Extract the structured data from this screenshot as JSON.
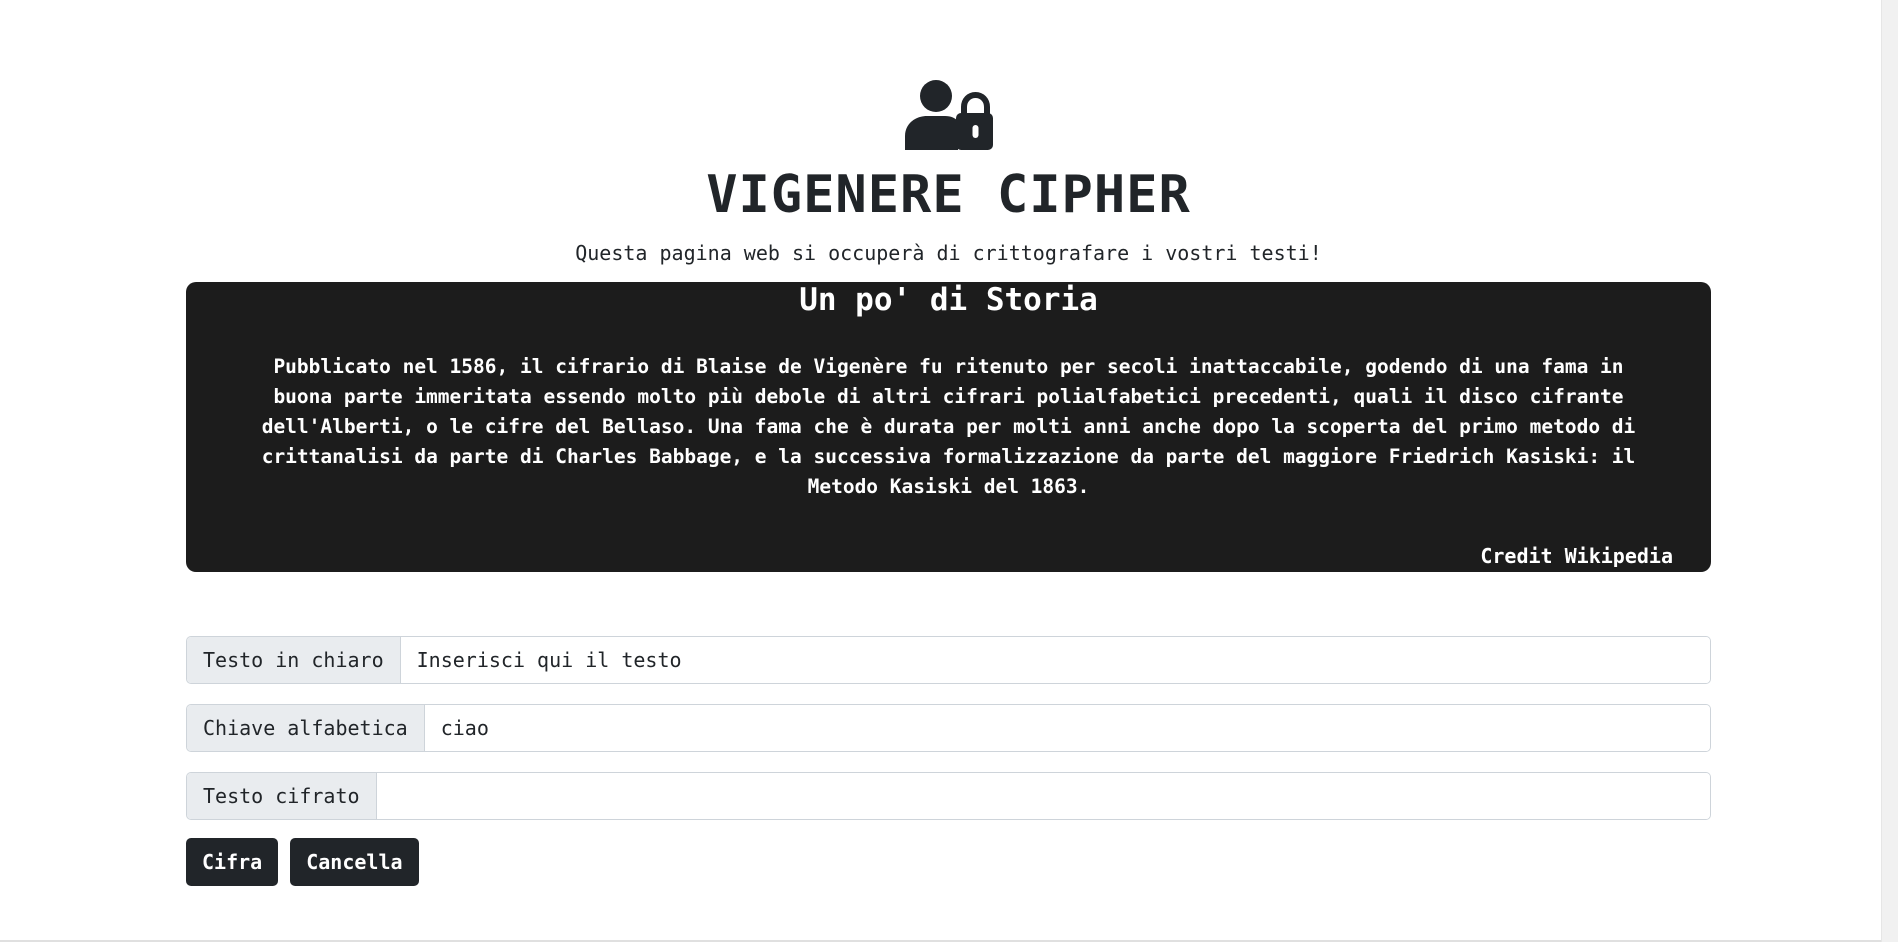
{
  "header": {
    "icon": "user-lock-icon",
    "title": "VIGENERE CIPHER",
    "subtitle": "Questa pagina web si occuperà di crittografare i vostri testi!"
  },
  "history": {
    "title": "Un po' di Storia",
    "text": "Pubblicato nel 1586, il cifrario di Blaise de Vigenère fu ritenuto per secoli inattaccabile, godendo di una fama in buona parte immeritata essendo molto più debole di altri cifrari polialfabetici precedenti, quali il disco cifrante dell'Alberti, o le cifre del Bellaso. Una fama che è durata per molti anni anche dopo la scoperta del primo metodo di crittanalisi da parte di Charles Babbage, e la successiva formalizzazione da parte del maggiore Friedrich Kasiski: il Metodo Kasiski del 1863.",
    "credit": "Credit Wikipedia"
  },
  "form": {
    "plaintext": {
      "label": "Testo in chiaro",
      "placeholder": "Inserisci qui il testo",
      "value": ""
    },
    "key": {
      "label": "Chiave alfabetica",
      "placeholder": "",
      "value": "ciao"
    },
    "ciphertext": {
      "label": "Testo cifrato",
      "placeholder": "",
      "value": ""
    }
  },
  "buttons": {
    "encrypt_label": "Cifra",
    "clear_label": "Cancella"
  },
  "colors": {
    "dark": "#212529",
    "card_background": "#1c1c1c",
    "label_background": "#e9ecef",
    "border": "#ced4da"
  }
}
